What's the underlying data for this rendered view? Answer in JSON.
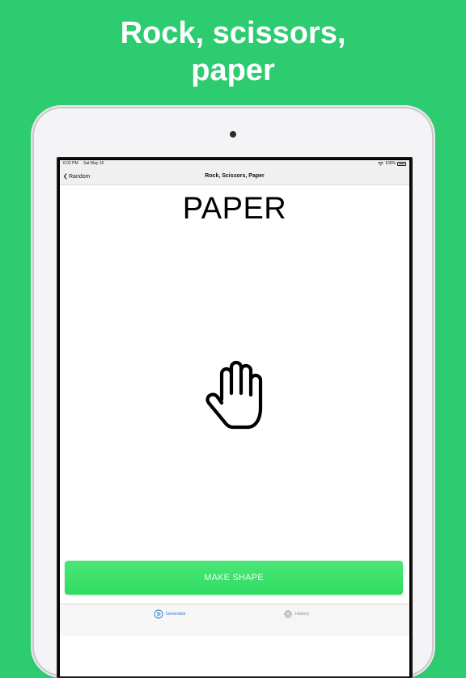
{
  "promo": {
    "headline_line1": "Rock, scissors,",
    "headline_line2": "paper"
  },
  "status_bar": {
    "time": "6:02 PM",
    "date": "Sat May 16",
    "battery": "100%"
  },
  "nav": {
    "back_label": "Random",
    "title": "Rock, Scissors, Paper"
  },
  "result": {
    "shape": "PAPER",
    "icon": "hand-paper-icon"
  },
  "action": {
    "button_label": "MAKE SHAPE"
  },
  "tabs": [
    {
      "label": "Generator",
      "icon": "play-circle-icon",
      "active": true
    },
    {
      "label": "History",
      "icon": "gear-icon",
      "active": false
    }
  ],
  "colors": {
    "background": "#2ecc71",
    "button": "#3ee26b",
    "active_tab": "#2a7bd6",
    "inactive_tab": "#8e8e93"
  }
}
